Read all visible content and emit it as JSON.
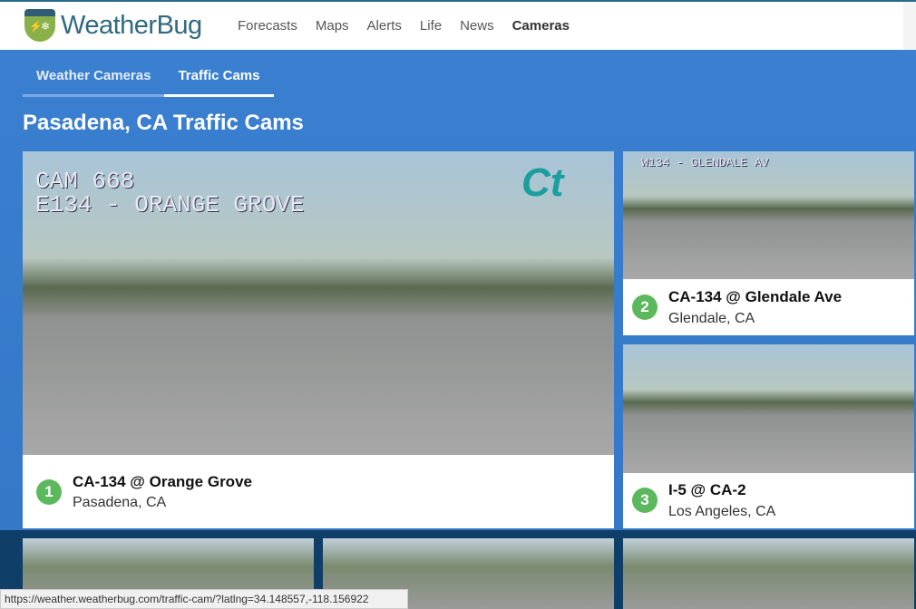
{
  "header": {
    "brand": "WeatherBug",
    "nav": [
      {
        "label": "Forecasts"
      },
      {
        "label": "Maps"
      },
      {
        "label": "Alerts"
      },
      {
        "label": "Life"
      },
      {
        "label": "News"
      },
      {
        "label": "Cameras",
        "active": true
      }
    ]
  },
  "tabs": [
    {
      "label": "Weather Cameras"
    },
    {
      "label": "Traffic Cams",
      "active": true
    }
  ],
  "page_title": "Pasadena, CA Traffic Cams",
  "cameras": [
    {
      "number": "1",
      "name": "CA-134 @ Orange Grove",
      "location": "Pasadena, CA",
      "overlay_line1": "CAM 668",
      "overlay_line2": "E134 - ORANGE GROVE"
    },
    {
      "number": "2",
      "name": "CA-134 @ Glendale Ave",
      "location": "Glendale, CA",
      "overlay_line1": "W134 - GLENDALE AV"
    },
    {
      "number": "3",
      "name": "I-5 @ CA-2",
      "location": "Los Angeles, CA"
    }
  ],
  "status_url": "https://weather.weatherbug.com/traffic-cam/?latlng=34.148557,-118.156922",
  "colors": {
    "accent": "#3a7fd0",
    "badge": "#5cb85c",
    "dark_band": "#0f3e68"
  }
}
